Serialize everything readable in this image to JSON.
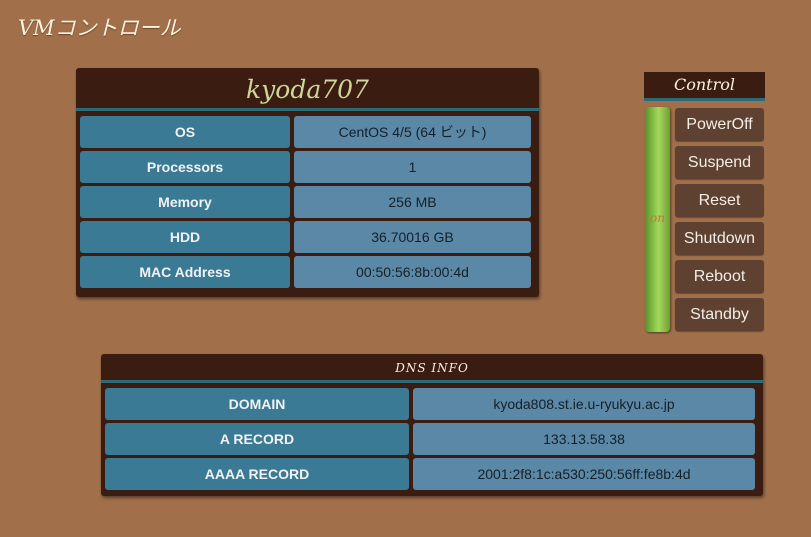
{
  "page": {
    "title": "VMコントロール"
  },
  "vm": {
    "name": "kyoda707",
    "rows": [
      {
        "label": "OS",
        "value": "CentOS 4/5 (64 ビット)"
      },
      {
        "label": "Processors",
        "value": "1"
      },
      {
        "label": "Memory",
        "value": "256 MB"
      },
      {
        "label": "HDD",
        "value": "36.70016 GB"
      },
      {
        "label": "MAC Address",
        "value": "00:50:56:8b:00:4d"
      }
    ]
  },
  "control": {
    "title": "Control",
    "state": "on",
    "buttons": [
      "PowerOff",
      "Suspend",
      "Reset",
      "Shutdown",
      "Reboot",
      "Standby"
    ]
  },
  "dns": {
    "title": "DNS INFO",
    "rows": [
      {
        "label": "DOMAIN",
        "value": "kyoda808.st.ie.u-ryukyu.ac.jp"
      },
      {
        "label": "A RECORD",
        "value": "133.13.58.38"
      },
      {
        "label": "AAAA RECORD",
        "value": "2001:2f8:1c:a530:250:56ff:fe8b:4d"
      }
    ]
  },
  "colors": {
    "background": "#a1704a",
    "panel": "#3b1c11",
    "key_cell": "#3a7a94",
    "value_cell": "#5b88a6",
    "power_on": "#8cc94b",
    "button": "#5e4130"
  }
}
